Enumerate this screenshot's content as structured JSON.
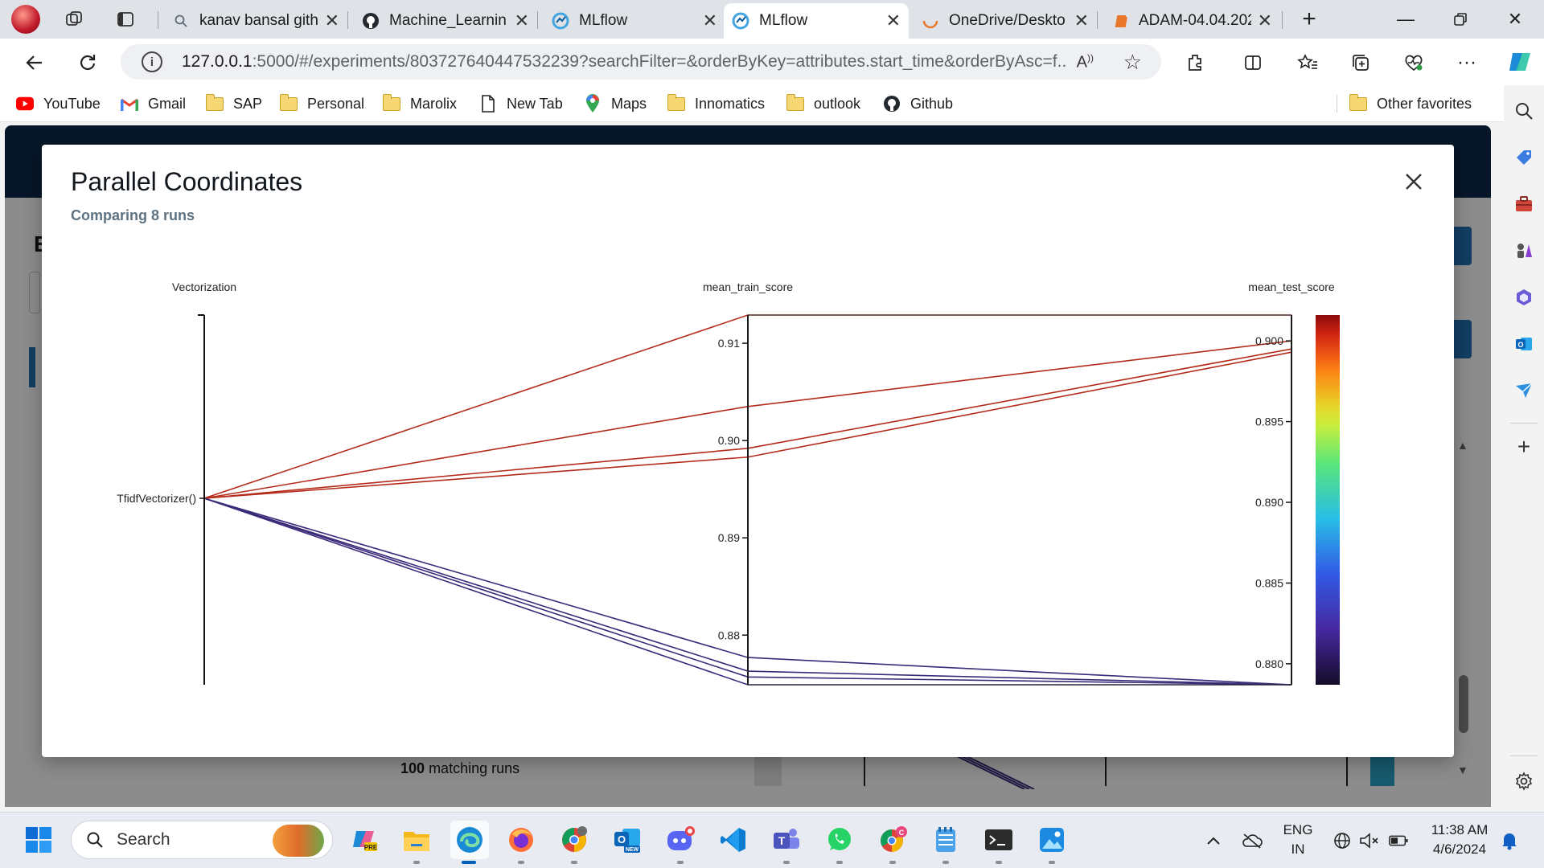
{
  "browser": {
    "tabs": [
      {
        "title": "kanav bansal gith",
        "icon": "search-icon"
      },
      {
        "title": "Machine_Learnin",
        "icon": "github-icon"
      },
      {
        "title": "MLflow",
        "icon": "mlflow-icon"
      },
      {
        "title": "MLflow",
        "icon": "mlflow-icon",
        "active": true
      },
      {
        "title": "OneDrive/Deskto",
        "icon": "onedrive-loading-icon"
      },
      {
        "title": "ADAM-04.04.202",
        "icon": "document-icon"
      }
    ],
    "url": {
      "host": "127.0.0.1",
      "path": ":5000/#/experiments/803727640447532239?searchFilter=&orderByKey=attributes.start_time&orderByAsc=f..."
    },
    "read_aloud_label": "A)",
    "favorites": [
      {
        "label": "YouTube",
        "icon": "youtube-icon"
      },
      {
        "label": "Gmail",
        "icon": "gmail-icon"
      },
      {
        "label": "SAP",
        "icon": "folder-icon"
      },
      {
        "label": "Personal",
        "icon": "folder-icon"
      },
      {
        "label": "Marolix",
        "icon": "folder-icon"
      },
      {
        "label": "New Tab",
        "icon": "page-icon"
      },
      {
        "label": "Maps",
        "icon": "maps-icon"
      },
      {
        "label": "Innomatics",
        "icon": "folder-icon"
      },
      {
        "label": "outlook",
        "icon": "folder-icon"
      },
      {
        "label": "Github",
        "icon": "github-icon"
      }
    ],
    "other_favorites": "Other favorites"
  },
  "page": {
    "matching_runs_count": "100",
    "matching_runs_text": "matching runs",
    "exp_letter": "E"
  },
  "modal": {
    "title": "Parallel Coordinates",
    "subtitle": "Comparing 8 runs",
    "close_icon": "close-icon"
  },
  "chart_data": {
    "type": "parallel_coordinates",
    "axes": [
      {
        "name": "Vectorization",
        "kind": "categorical",
        "categories": [
          "TfidfVectorizer()"
        ]
      },
      {
        "name": "mean_train_score",
        "kind": "numeric",
        "range": [
          0.8749,
          0.9129
        ],
        "ticks": [
          0.88,
          0.89,
          0.9,
          0.91
        ]
      },
      {
        "name": "mean_test_score",
        "kind": "numeric",
        "range": [
          0.8787,
          0.9016
        ],
        "ticks": [
          0.88,
          0.885,
          0.89,
          0.895,
          0.9
        ]
      }
    ],
    "color_axis": "mean_test_score",
    "colorscale": "jet",
    "runs": [
      {
        "Vectorization": "TfidfVectorizer()",
        "mean_train_score": 0.9129,
        "mean_test_score": 0.9016
      },
      {
        "Vectorization": "TfidfVectorizer()",
        "mean_train_score": 0.9035,
        "mean_test_score": 0.9
      },
      {
        "Vectorization": "TfidfVectorizer()",
        "mean_train_score": 0.8992,
        "mean_test_score": 0.8995
      },
      {
        "Vectorization": "TfidfVectorizer()",
        "mean_train_score": 0.8983,
        "mean_test_score": 0.8993
      },
      {
        "Vectorization": "TfidfVectorizer()",
        "mean_train_score": 0.8777,
        "mean_test_score": 0.8787
      },
      {
        "Vectorization": "TfidfVectorizer()",
        "mean_train_score": 0.8763,
        "mean_test_score": 0.8787
      },
      {
        "Vectorization": "TfidfVectorizer()",
        "mean_train_score": 0.8757,
        "mean_test_score": 0.8787
      },
      {
        "Vectorization": "TfidfVectorizer()",
        "mean_train_score": 0.8749,
        "mean_test_score": 0.8787
      }
    ],
    "colors": {
      "high": "#b42b1a",
      "low": "#3b2a7a"
    }
  },
  "taskbar": {
    "search_text": "Search",
    "lang_top": "ENG",
    "lang_bottom": "IN",
    "time": "11:38 AM",
    "date": "4/6/2024"
  }
}
